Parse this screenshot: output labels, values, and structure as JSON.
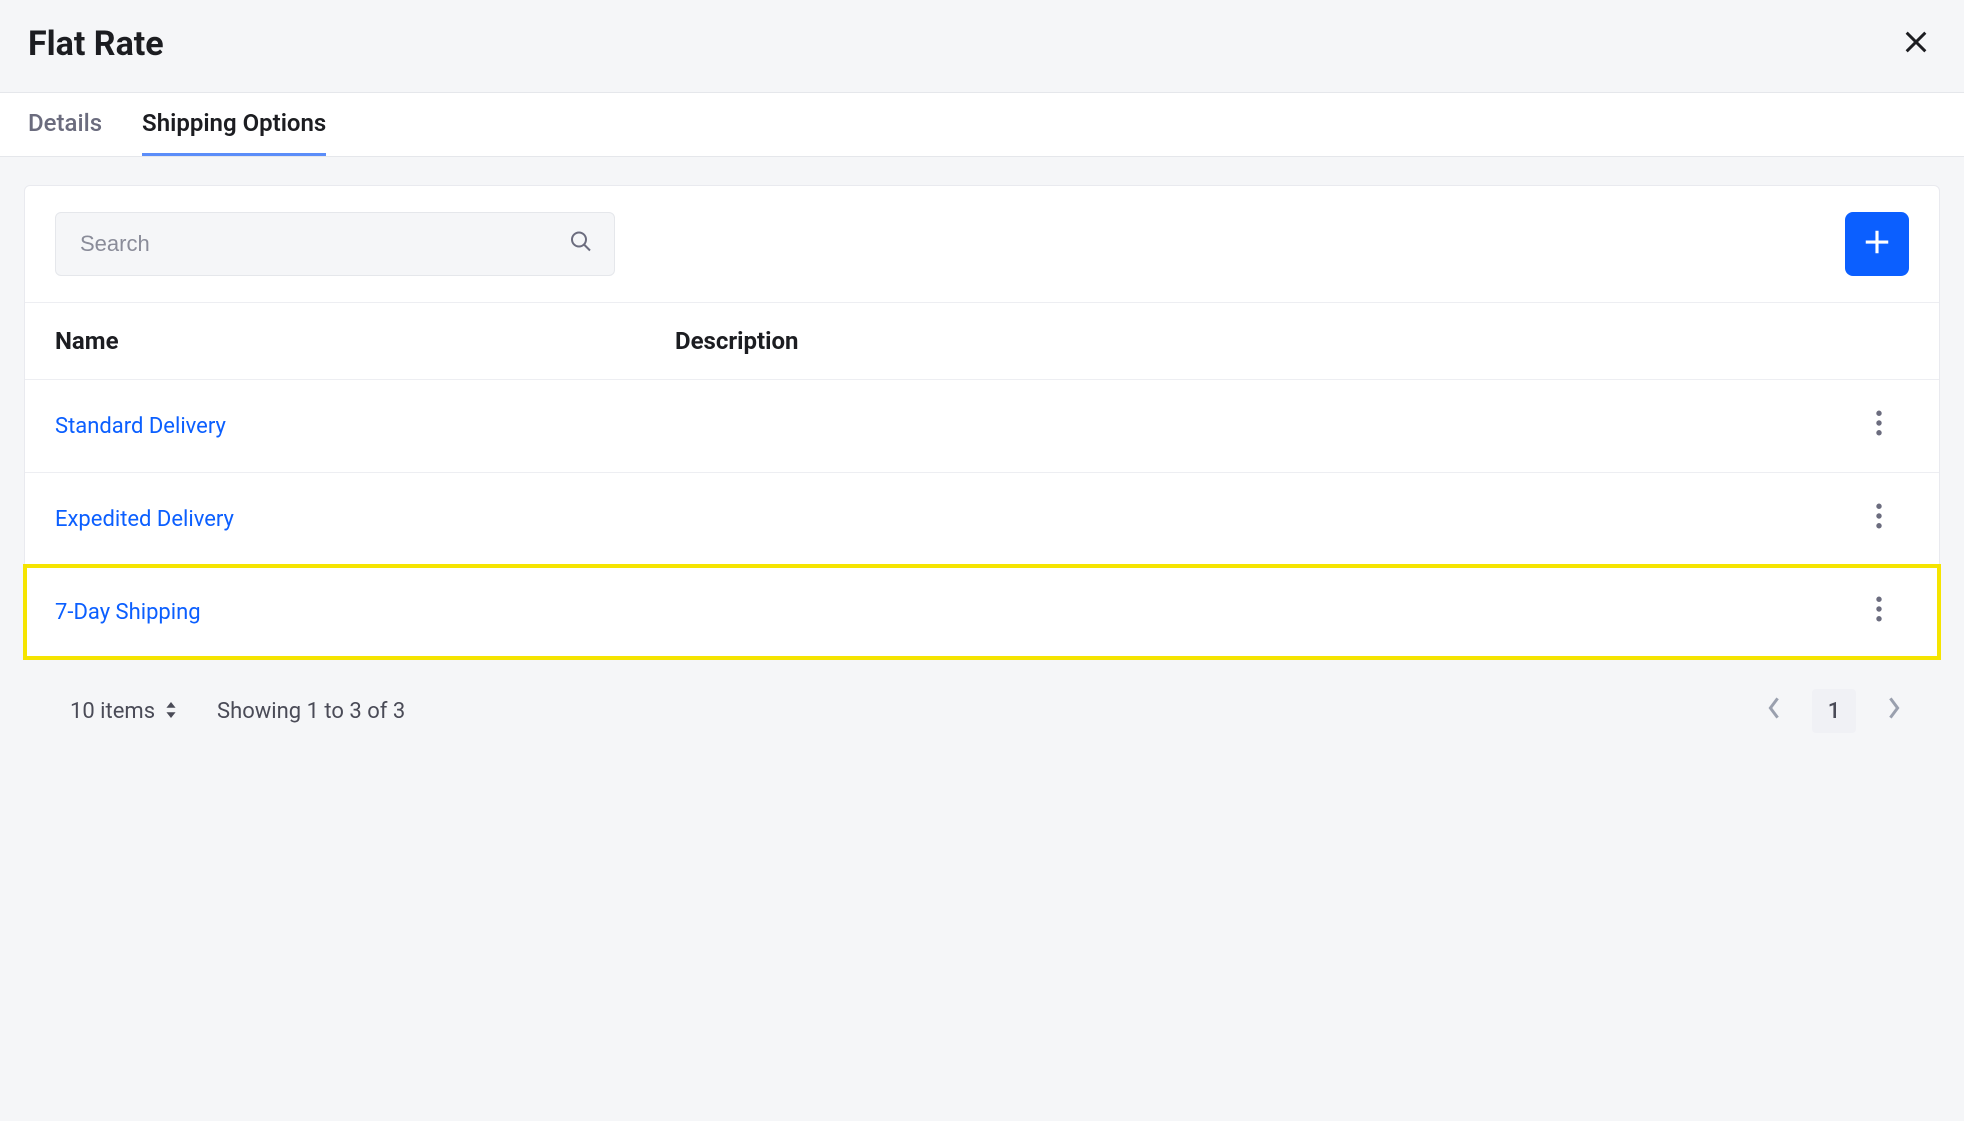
{
  "header": {
    "title": "Flat Rate"
  },
  "tabs": [
    {
      "label": "Details",
      "active": false
    },
    {
      "label": "Shipping Options",
      "active": true
    }
  ],
  "search": {
    "placeholder": "Search"
  },
  "table": {
    "columns": {
      "name": "Name",
      "description": "Description"
    },
    "rows": [
      {
        "name": "Standard Delivery",
        "description": "",
        "highlight": false
      },
      {
        "name": "Expedited Delivery",
        "description": "",
        "highlight": false
      },
      {
        "name": "7-Day Shipping",
        "description": "",
        "highlight": true
      }
    ]
  },
  "footer": {
    "page_size_label": "10 items",
    "showing": "Showing 1 to 3 of 3",
    "current_page": "1"
  }
}
